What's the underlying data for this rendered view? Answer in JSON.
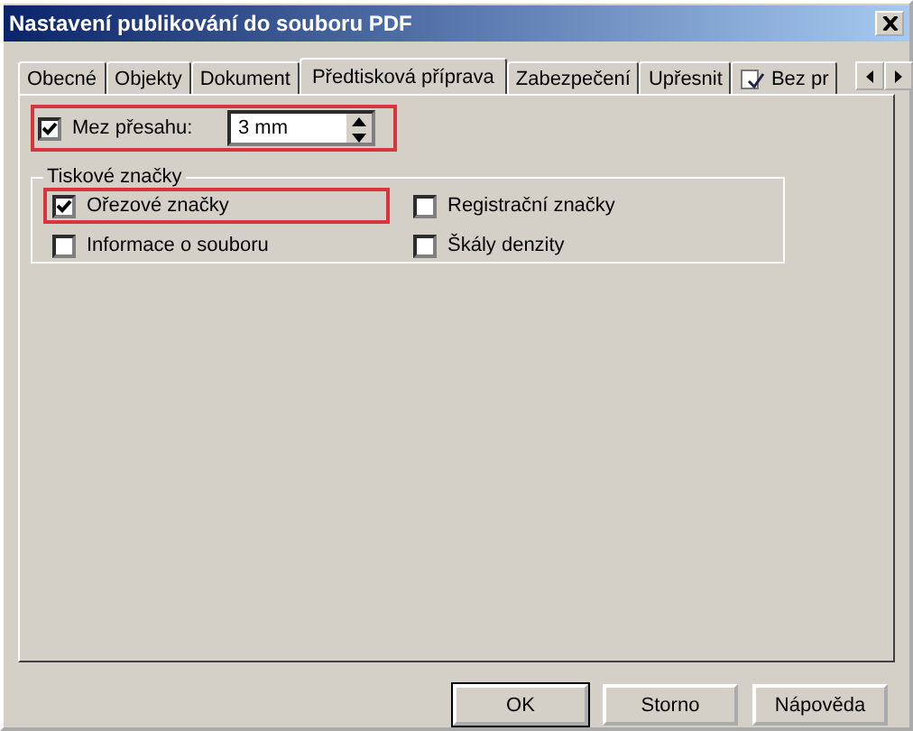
{
  "window": {
    "title": "Nastavení publikování do souboru PDF"
  },
  "tabs": [
    {
      "label": "Obecné",
      "selected": false
    },
    {
      "label": "Objekty",
      "selected": false
    },
    {
      "label": "Dokument",
      "selected": false
    },
    {
      "label": "Předtisková příprava",
      "selected": true
    },
    {
      "label": "Zabezpečení",
      "selected": false
    },
    {
      "label": "Upřesnit",
      "selected": false
    },
    {
      "label": "Bez pr",
      "selected": false,
      "kind": "icon"
    }
  ],
  "bleed": {
    "label": "Mez přesahu:",
    "checked": true,
    "value": "3 mm",
    "highlighted": true
  },
  "printer_marks": {
    "title": "Tiskové značky",
    "items": [
      {
        "label": "Ořezové značky",
        "checked": true,
        "highlighted": true
      },
      {
        "label": "Registrační značky",
        "checked": false,
        "highlighted": false
      },
      {
        "label": "Informace o souboru",
        "checked": false,
        "highlighted": false
      },
      {
        "label": "Škály denzity",
        "checked": false,
        "highlighted": false
      }
    ]
  },
  "buttons": [
    {
      "label": "OK",
      "default": true
    },
    {
      "label": "Storno",
      "default": false
    },
    {
      "label": "Nápověda",
      "default": false
    }
  ]
}
